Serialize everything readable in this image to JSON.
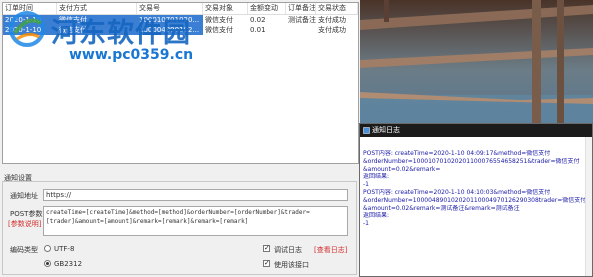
{
  "table": {
    "headers": [
      "订单时间",
      "支付方式",
      "交易号",
      "交易对象",
      "金额变动",
      "订单备注",
      "交易状态"
    ],
    "rows": [
      {
        "time": "2020-1-10",
        "method": "微信支付",
        "trade_no": "100010701020...",
        "target": "微信支付",
        "amount": "0.02",
        "remark": "测试备注",
        "status": "支付成功",
        "selected": true
      },
      {
        "time": "2020-1-10",
        "method": "微信支付",
        "trade_no": "100004890102...",
        "target": "微信支付",
        "amount": "0.01",
        "remark": "",
        "status": "支付成功",
        "selected": false
      }
    ]
  },
  "watermark": {
    "title": "河东软件园",
    "url": "www.pc0359.cn"
  },
  "settings": {
    "group_title": "通知设置",
    "url_label": "通知地址",
    "url_value": "https://",
    "post_label": "POST参数",
    "post_help": "[参数说明]",
    "post_value": "createTime=[createTime]&method=[method]&orderNumber=[orderNumber]&trader=[trader]&amount=[amount]&remark=[remark]&remark=[remark]",
    "encoding_label": "编码类型",
    "enc_utf8": "UTF-8",
    "enc_gb2312": "GB2312",
    "encoding_selected": "GB2312",
    "debug_log": "调试日志",
    "view_log": "[查看日志]",
    "use_api": "使用该接口",
    "debug_checked": true,
    "use_api_checked": true
  },
  "log": {
    "title": "通知日志",
    "lines": [
      "POST内容: createTime=2020-1-10 04:09:17&method=微信支付",
      "&orderNumber=100010701020201100076554658251&trader=微信支付",
      "&amount=0.02&remark=",
      "返回结果:",
      "-1",
      "POST内容: createTime=2020-1-10 04:10:03&method=微信支付",
      "&orderNumber=100004890102020110004970126290308trader=微信支付",
      "&amount=0.02&remark=测试备注&remark=测试备注",
      "返回结果:",
      "-1"
    ]
  }
}
